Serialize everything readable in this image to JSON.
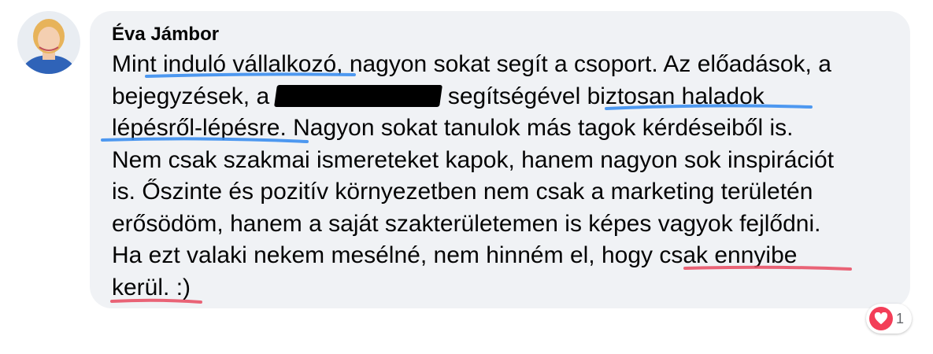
{
  "comment": {
    "author": "Éva Jámbor",
    "lines": [
      "Mint induló vállalkozó, nagyon sokat segít a csoport. Az előadások, a",
      "bejegyzések, a",
      "segítségével biztosan haladok",
      "lépésről-lépésre. Nagyon sokat tanulok más tagok kérdéseiből is.",
      "Nem csak szakmai ismereteket kapok, hanem nagyon sok inspirációt",
      "is. Őszinte és pozitív környezetben nem csak a marketing területén",
      "erősödöm, hanem a saját szakterületemen is képes vagyok fejlődni.",
      "Ha ezt valaki nekem mesélné, nem hinném el, hogy csak ennyibe",
      "kerül. :)"
    ],
    "reactions": {
      "icon": "heart-icon",
      "count": "1",
      "color": "#f33e58"
    }
  },
  "colors": {
    "bubble": "#f0f2f5",
    "highlight_blue": "#3b8ef0",
    "highlight_red": "#e84a5f"
  }
}
